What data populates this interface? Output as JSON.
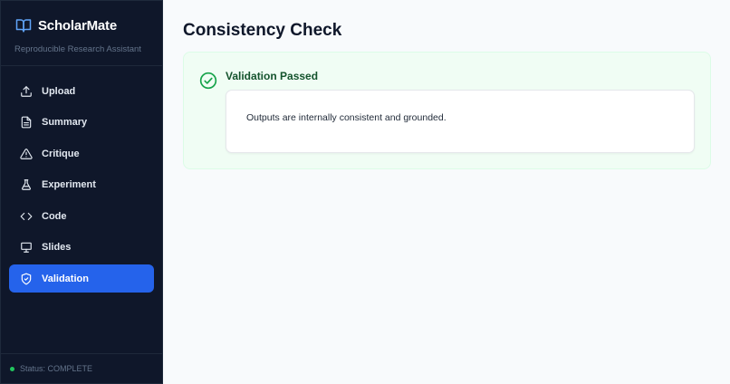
{
  "app": {
    "name": "ScholarMate",
    "subtitle": "Reproducible Research Assistant",
    "icon": "book-open-icon"
  },
  "sidebar": {
    "items": [
      {
        "label": "Upload",
        "icon": "upload-icon",
        "active": false
      },
      {
        "label": "Summary",
        "icon": "file-text-icon",
        "active": false
      },
      {
        "label": "Critique",
        "icon": "alert-triangle-icon",
        "active": false
      },
      {
        "label": "Experiment",
        "icon": "flask-icon",
        "active": false
      },
      {
        "label": "Code",
        "icon": "code-icon",
        "active": false
      },
      {
        "label": "Slides",
        "icon": "presentation-icon",
        "active": false
      },
      {
        "label": "Validation",
        "icon": "shield-check-icon",
        "active": true
      }
    ],
    "status": "Status: COMPLETE",
    "status_color": "#22c55e"
  },
  "main": {
    "title": "Consistency Check",
    "result": {
      "title": "Validation Passed",
      "icon": "check-circle-icon",
      "message": "Outputs are internally consistent and grounded."
    }
  },
  "colors": {
    "sidebar_bg": "#0f172a",
    "accent": "#2563eb",
    "success": "#16a34a",
    "success_bg": "#f0fdf4"
  }
}
